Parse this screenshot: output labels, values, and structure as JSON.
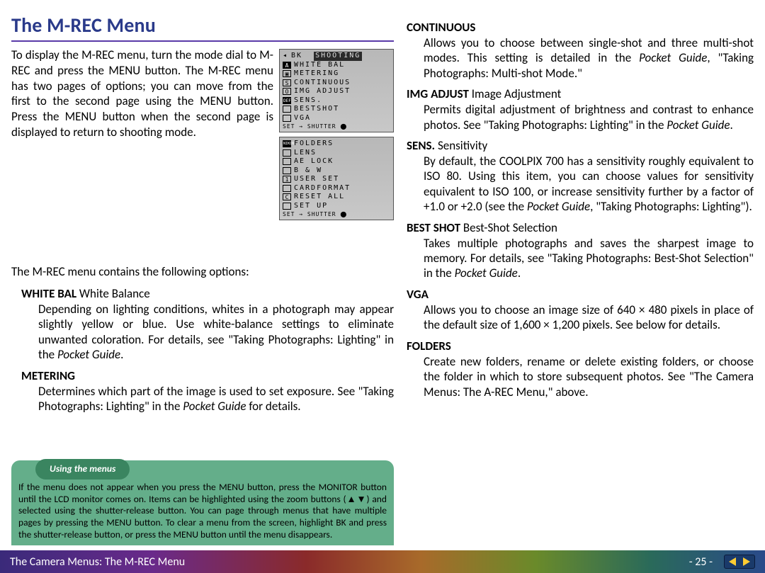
{
  "title": "The M-REC Menu",
  "intro": "To display the M-REC menu, turn the mode dial to M-REC and press the MENU button. The M-REC menu has two pages of options; you can move from the first to the second page using the MENU button.  Press the MENU button when the second page is displayed to return to shooting mode.",
  "screen1": {
    "bk": "BK",
    "header": "SHOOTING",
    "rows": [
      {
        "icon": "A",
        "label": "WHITE BAL"
      },
      {
        "icon": "▣",
        "label": "METERING"
      },
      {
        "icon": "S",
        "label": "CONTINUOUS"
      },
      {
        "icon": "O",
        "label": "IMG ADJUST"
      },
      {
        "icon": "DEF",
        "label": "SENS."
      },
      {
        "icon": "",
        "label": "BESTSHOT"
      },
      {
        "icon": "",
        "label": "VGA"
      }
    ],
    "foot": "SET → SHUTTER ⬤"
  },
  "screen2": {
    "brand": "NIKON",
    "rows": [
      {
        "icon": "",
        "label": "FOLDERS"
      },
      {
        "icon": "□",
        "label": "LENS"
      },
      {
        "icon": "□",
        "label": "AE LOCK"
      },
      {
        "icon": "□",
        "label": "B & W"
      },
      {
        "icon": "1",
        "label": "USER SET"
      },
      {
        "icon": "□",
        "label": "CARDFORMAT"
      },
      {
        "icon": "C",
        "label": "RESET ALL"
      },
      {
        "icon": "",
        "label": "SET UP"
      }
    ],
    "foot": "SET → SHUTTER ⬤"
  },
  "contains": "The M-REC menu contains the following options:",
  "left": {
    "wb_h": "WHITE BAL",
    "wb_sub": " White Balance",
    "wb_d": "Depending on lighting conditions, whites in a photograph may appear slightly yellow or blue.  Use white-balance settings to eliminate unwanted coloration.  For details, see \"Taking Photographs: Lighting\" in the ",
    "wb_pg": "Pocket Guide",
    "wb_end": ".",
    "mt_h": "METERING",
    "mt_d1": "Determines which part of the image is used to set exposure. See \"Taking Photographs: Lighting\" in the ",
    "mt_pg": "Pocket Guide",
    "mt_d2": " for details."
  },
  "tip": {
    "tab": "Using the menus",
    "body": "If the menu does not appear when you press the MENU button, press the MONITOR button until the LCD monitor comes on.  Items can be highlighted using the zoom buttons (▲▼) and selected using the shutter-release button.  You can page through menus that have multiple pages by pressing the MENU button.  To clear a menu from the screen, highlight BK and press the shutter-release button, or press the MENU button until the menu disappears."
  },
  "right": {
    "cont_h": "CONTINUOUS",
    "cont_d1": "Allows you to choose between single-shot and three multi-shot modes.  This setting is detailed in the ",
    "cont_pg": "Pocket Guide",
    "cont_d2": ", \"Taking Photographs: Multi-shot Mode.\"",
    "img_h": "IMG ADJUST",
    "img_sub": " Image Adjustment",
    "img_d1": "Permits digital adjustment of brightness and contrast to enhance photos.  See \"Taking Photographs: Lighting\" in the ",
    "img_pg": "Pocket Guide",
    "img_d2": ".",
    "sens_h": "SENS.",
    "sens_sub": " Sensitivity",
    "sens_d1": "By default, the COOLPIX 700 has a sensitivity roughly equivalent to ISO 80.  Using this item, you can choose values for sensitivity equivalent to ISO 100, or increase sensitivity further by a factor of +1.0 or +2.0 (see the ",
    "sens_pg": "Pocket Guide",
    "sens_d2": ", \"Taking Photographs: Lighting\").",
    "bs_h": "BEST SHOT",
    "bs_sub": " Best-Shot Selection",
    "bs_d1": "Takes multiple photographs and saves the sharpest image to memory.  For details, see \"Taking Photographs: Best-Shot Selection\" in the ",
    "bs_pg": "Pocket Guide",
    "bs_d2": ".",
    "vga_h": "VGA",
    "vga_d": "Allows you to choose an image size of 640 × 480 pixels in place of the default size of 1,600 × 1,200 pixels.   See below for details.",
    "fold_h": "FOLDERS",
    "fold_d": "Create new folders, rename or delete existing folders, or choose the folder in which to store subsequent photos.  See \"The Camera Menus: The A-REC Menu,\" above."
  },
  "footer": {
    "left": "The Camera Menus: The M-REC Menu",
    "page": "- 25 -"
  }
}
